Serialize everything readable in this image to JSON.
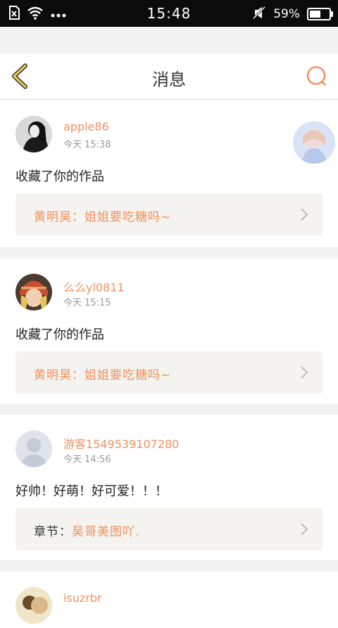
{
  "statusbar": {
    "time": "15:48",
    "battery_pct": "59%",
    "battery_level": 0.59
  },
  "header": {
    "title": "消息"
  },
  "messages": [
    {
      "user": "apple86",
      "time": "今天 15:38",
      "comment": "收藏了你的作品",
      "quote_label": "",
      "quote": "黄明昊：姐姐要吃糖吗~",
      "has_thumbnail": true
    },
    {
      "user": "么么yl0811",
      "time": "今天 15:15",
      "comment": "收藏了你的作品",
      "quote_label": "",
      "quote": "黄明昊：姐姐要吃糖吗~",
      "has_thumbnail": false
    },
    {
      "user": "游客1549539107280",
      "time": "今天 14:56",
      "comment": "好帅！好萌！好可爱！！！",
      "quote_label": "章节：",
      "quote": "昊哥美图吖.",
      "has_thumbnail": false
    },
    {
      "user": "isuzrbr"
    }
  ],
  "colors": {
    "accent": "#f0915e",
    "back_arrow": "#e8d44c"
  }
}
